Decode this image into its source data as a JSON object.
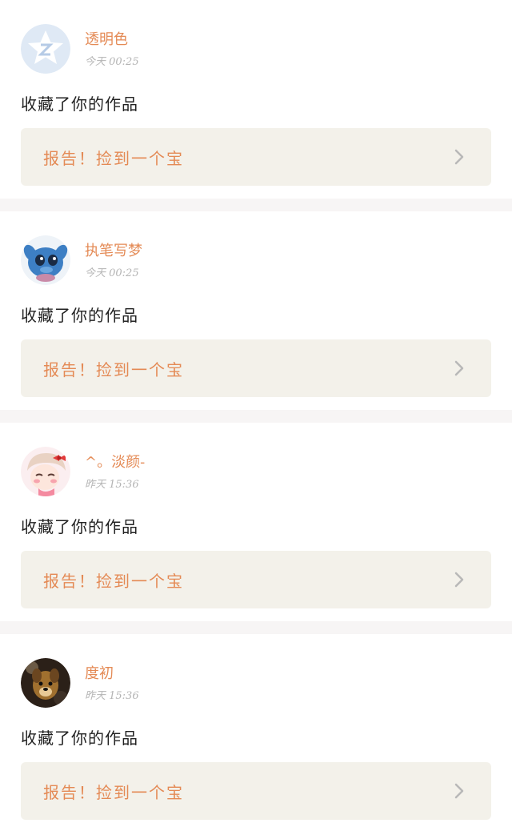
{
  "notifications": [
    {
      "username": "透明色",
      "timestamp": "今天 00:25",
      "action": "收藏了你的作品",
      "banner": "报告！捡到一个宝",
      "avatar_icon": "qzone-star-avatar-icon"
    },
    {
      "username": "执笔写梦",
      "timestamp": "今天 00:25",
      "action": "收藏了你的作品",
      "banner": "报告！捡到一个宝",
      "avatar_icon": "stitch-cartoon-avatar-icon"
    },
    {
      "username": "^。淡颜-",
      "timestamp": "昨天 15:36",
      "action": "收藏了你的作品",
      "banner": "报告！捡到一个宝",
      "avatar_icon": "anime-girl-avatar-icon"
    },
    {
      "username": "度初",
      "timestamp": "昨天 15:36",
      "action": "收藏了你的作品",
      "banner": "报告！捡到一个宝",
      "avatar_icon": "dog-photo-avatar-icon"
    }
  ],
  "colors": {
    "accent": "#e48a55",
    "banner_bg": "#f3f1ea",
    "divider": "#f7f5f5"
  }
}
